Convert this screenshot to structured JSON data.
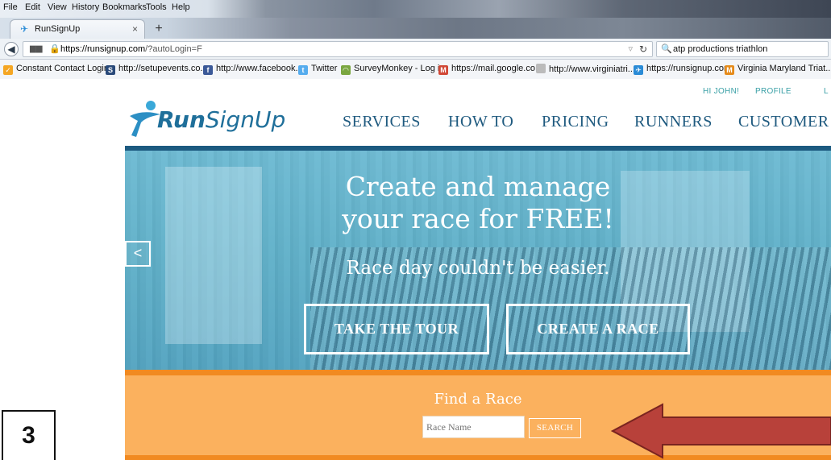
{
  "browser": {
    "menu": [
      "File",
      "Edit",
      "View",
      "History",
      "Bookmarks",
      "Tools",
      "Help"
    ],
    "tab_title": "RunSignUp",
    "tab_close": "×",
    "new_tab": "+",
    "url_host": "https://runsignup.com",
    "url_path": "/?autoLogin=F",
    "search_query": "atp productions triathlon",
    "bookmarks": [
      {
        "label": "Constant Contact Login",
        "icon": "contact-icon",
        "color": "#f5a623"
      },
      {
        "label": "http://setupevents.co...",
        "icon": "setup-icon",
        "color": "#2a4a7a"
      },
      {
        "label": "http://www.facebook....",
        "icon": "facebook-icon",
        "color": "#3b5998"
      },
      {
        "label": "Twitter",
        "icon": "twitter-icon",
        "color": "#55acee"
      },
      {
        "label": "SurveyMonkey - Log in",
        "icon": "surveymonkey-icon",
        "color": "#7aa640"
      },
      {
        "label": "https://mail.google.co...",
        "icon": "gmail-icon",
        "color": "#d14836"
      },
      {
        "label": "http://www.virginiatri...",
        "icon": "page-icon",
        "color": "#bbbbbb"
      },
      {
        "label": "https://runsignup.com",
        "icon": "runsignup-icon",
        "color": "#2a8bd6"
      },
      {
        "label": "Virginia Maryland Triat...",
        "icon": "vmt-icon",
        "color": "#e58b1b"
      }
    ]
  },
  "site": {
    "top_links": {
      "greeting": "HI JOHN!",
      "profile": "PROFILE",
      "logout": "L"
    },
    "logo_text_run": "Run",
    "logo_text_signup": "SignUp",
    "nav": [
      "SERVICES",
      "HOW TO",
      "PRICING",
      "RUNNERS",
      "CUSTOMER"
    ],
    "hero": {
      "title_line1": "Create and manage",
      "title_line2": "your race for FREE!",
      "subtitle": "Race day couldn't be easier.",
      "prev_arrow": "<",
      "cta_tour": "TAKE THE TOUR",
      "cta_create": "CREATE A RACE"
    },
    "find": {
      "title": "Find a Race",
      "placeholder": "Race Name",
      "button": "SEARCH"
    }
  },
  "annotation": {
    "step_number": "3",
    "arrow_color": "#b8413a"
  }
}
